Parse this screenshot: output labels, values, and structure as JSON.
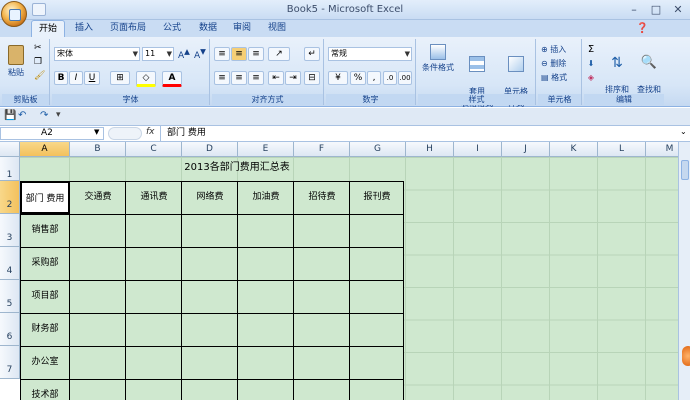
{
  "window": {
    "title": "Book5 - Microsoft Excel",
    "minimize": "–",
    "maximize": "□",
    "close": "✕"
  },
  "tabs": [
    "开始",
    "插入",
    "页面布局",
    "公式",
    "数据",
    "审阅",
    "视图"
  ],
  "ribbon": {
    "clipboard": {
      "label": "剪贴板",
      "paste": "粘贴"
    },
    "font": {
      "label": "字体",
      "name": "宋体",
      "size": "11",
      "bold": "B",
      "italic": "I",
      "underline": "U"
    },
    "alignment": {
      "label": "对齐方式"
    },
    "number": {
      "label": "数字",
      "format": "常规",
      "percent": "%",
      "comma": ","
    },
    "styles": {
      "label": "样式",
      "conditional": "条件格式",
      "table": "套用\n表格格式",
      "cell": "单元格\n样式"
    },
    "cells": {
      "label": "单元格",
      "insert": "插入",
      "delete": "删除",
      "format": "格式"
    },
    "editing": {
      "label": "编辑",
      "sort": "排序和\n筛选",
      "find": "查找和\n选择",
      "sum": "Σ"
    }
  },
  "formula_bar": {
    "name_box": "A2",
    "fx": "fx",
    "content": "部门  费用"
  },
  "columns": [
    "A",
    "B",
    "C",
    "D",
    "E",
    "F",
    "G",
    "H",
    "I",
    "J",
    "K",
    "L",
    "M"
  ],
  "rows": [
    "1",
    "2",
    "3",
    "4",
    "5",
    "6",
    "7"
  ],
  "sheet": {
    "title": "2013各部门费用汇总表",
    "header": [
      "部门  费用",
      "交通费",
      "通讯费",
      "网络费",
      "加油费",
      "招待费",
      "报刊费"
    ],
    "departments": [
      "销售部",
      "采购部",
      "项目部",
      "财务部",
      "办公室",
      "技术部"
    ]
  },
  "colors": {
    "grid_bg": "#cfe8cf",
    "selected_header": "#f3c15d",
    "ribbon_text": "#15428b"
  }
}
